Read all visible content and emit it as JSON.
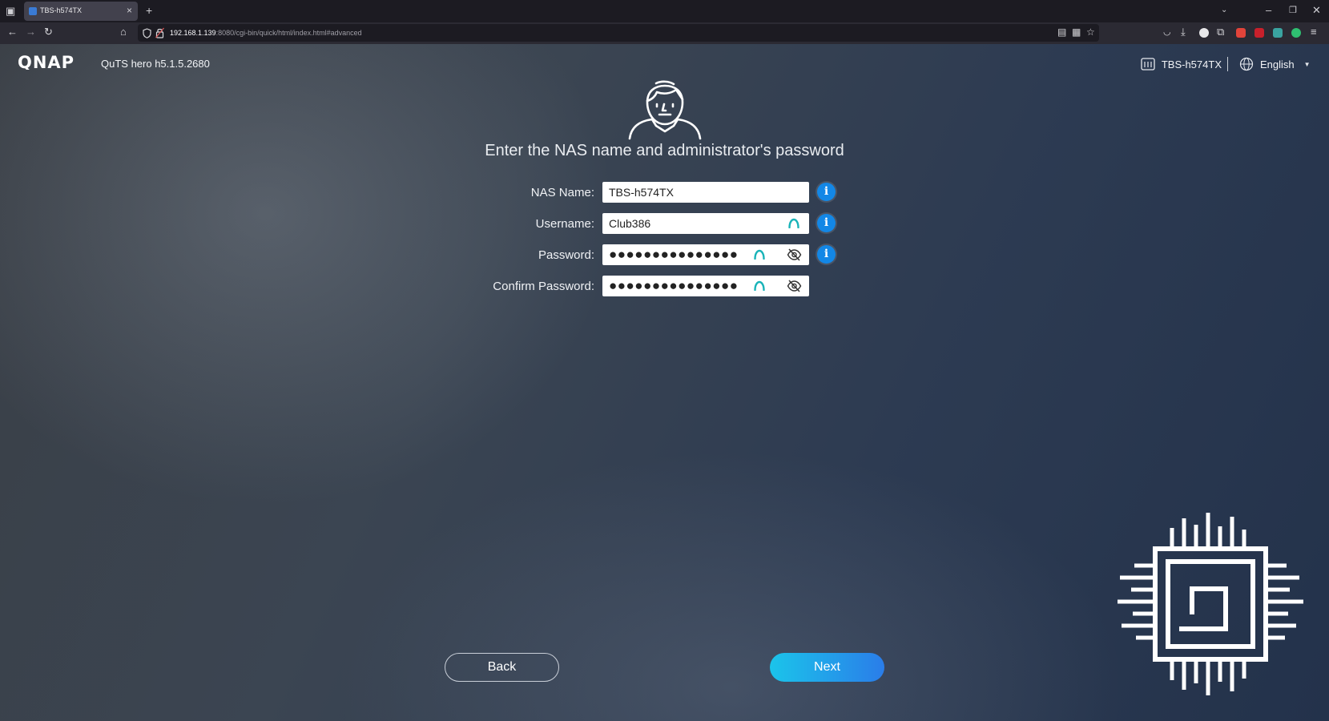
{
  "browser": {
    "tab_title": "TBS-h574TX",
    "tab_close": "×",
    "new_tab": "+",
    "url_host": "192.168.1.139",
    "url_rest": ":8080/cgi-bin/quick/html/index.html#advanced"
  },
  "header": {
    "logo_text": "QNAP",
    "os_version": "QuTS hero h5.1.5.2680",
    "device_name": "TBS-h574TX",
    "language": "English"
  },
  "main": {
    "heading": "Enter the NAS name and administrator's password",
    "fields": {
      "nas_name": {
        "label": "NAS Name:",
        "value": "TBS-h574TX"
      },
      "username": {
        "label": "Username:",
        "value": "Club386"
      },
      "password": {
        "label": "Password:",
        "value": "●●●●●●●●●●●●●●●"
      },
      "confirm_password": {
        "label": "Confirm Password:",
        "value": "●●●●●●●●●●●●●●●"
      }
    },
    "info_glyph": "i"
  },
  "buttons": {
    "back": "Back",
    "next": "Next"
  },
  "colors": {
    "accent": "#1387e6",
    "next_start": "#1bc4ea",
    "next_end": "#2a7de9",
    "brand_teal": "#19b3b8"
  },
  "icons": [
    "user-avatar-icon",
    "nas-device-icon",
    "globe-icon",
    "info-icon",
    "password-manager-icon",
    "eye-slash-icon",
    "chip-icon"
  ]
}
